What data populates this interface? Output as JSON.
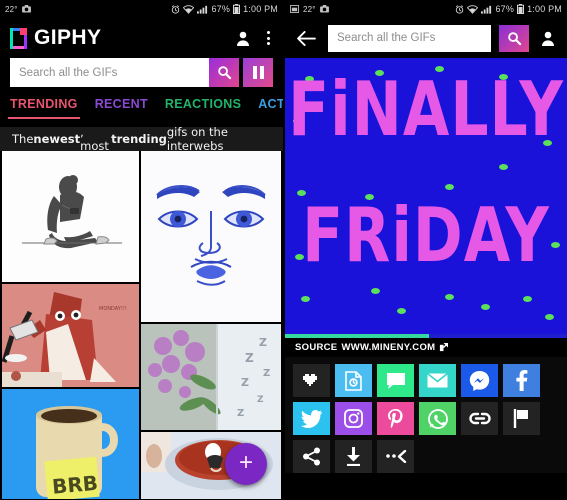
{
  "status_bar": {
    "temperature": "22°",
    "time": "1:00 PM",
    "battery_percent": "67%",
    "icons": [
      "screenshot-icon",
      "camera-icon",
      "alarm-icon",
      "wifi-icon",
      "signal-icon",
      "battery-icon"
    ]
  },
  "left_screen": {
    "app_title": "GIPHY",
    "actions": [
      {
        "name": "profile-icon",
        "label": "Profile"
      },
      {
        "name": "overflow-menu-icon",
        "label": "More options"
      }
    ],
    "search": {
      "placeholder": "Search all the GIFs",
      "value": "",
      "search_button": "search-icon",
      "pause_button": "pause-icon"
    },
    "tabs": [
      {
        "label": "TRENDING",
        "color": "#e8556f",
        "active": true
      },
      {
        "label": "RECENT",
        "color": "#8a4ad0",
        "active": false
      },
      {
        "label": "REACTIONS",
        "color": "#23b36a",
        "active": false
      },
      {
        "label": "ACTIO",
        "color": "#3a9ee0",
        "active": false
      }
    ],
    "banner": {
      "part1": "The ",
      "bold1": "newest",
      "part2": ", most ",
      "bold2": "trending",
      "part3": " gifs on the interwebs"
    },
    "gif_cards": [
      {
        "name": "gif-card-sketch-sitting",
        "description": "Pencil sketch of a person sitting on the ground looking at a phone"
      },
      {
        "name": "gif-card-red-fox",
        "description": "Illustration of a red fox at a desk with a lamp"
      },
      {
        "name": "gif-card-brb-coffee-mug",
        "description": "Coffee mug with a yellow BRB sticky note on blue background",
        "text": "BRB"
      },
      {
        "name": "gif-card-blue-pen-face",
        "description": "Blue ballpoint pen drawing of a woman's face"
      },
      {
        "name": "gif-card-flowers-sleep",
        "description": "Lilac flowers with floating Z sleep letters",
        "text": "Z"
      },
      {
        "name": "gif-card-coffee-cup-bath",
        "description": "Cartoon person bathing in a cup of coffee"
      }
    ],
    "fab": {
      "name": "create-gif-fab",
      "label": "+"
    }
  },
  "right_screen": {
    "back_button": "back-arrow-icon",
    "profile_button": "profile-icon",
    "search": {
      "placeholder": "Search all the GIFs",
      "value": "",
      "search_button": "search-icon"
    },
    "gif_detail": {
      "line1": "FiNALLY",
      "line2": "FRiDAY",
      "background_color": "#1a12d8",
      "text_color": "#e659e6",
      "dot_color": "#5ce05c",
      "progress_percent": 51
    },
    "source": {
      "label": "SOURCE",
      "url": "WWW.MINENY.COM",
      "icon": "external-link-icon"
    },
    "share_targets": [
      [
        {
          "name": "favorite-tile",
          "label": "Favorite",
          "icon": "pixel-heart-icon",
          "bg": "#232323",
          "fg": "#ffffff"
        },
        {
          "name": "saveto-tile",
          "label": "Save to",
          "icon": "document-save-icon",
          "bg": "#4cbdf0",
          "fg": "#ffffff"
        },
        {
          "name": "message-tile",
          "label": "Messages",
          "icon": "chat-bubble-icon",
          "bg": "#2ee88a",
          "fg": "#ffffff"
        },
        {
          "name": "email-tile",
          "label": "Email",
          "icon": "envelope-icon",
          "bg": "#33d6c8",
          "fg": "#ffffff"
        },
        {
          "name": "messenger-tile",
          "label": "Messenger",
          "icon": "messenger-icon",
          "bg": "#1b59e8",
          "fg": "#ffffff"
        },
        {
          "name": "facebook-tile",
          "label": "Facebook",
          "icon": "facebook-icon",
          "bg": "#3f7fe0",
          "fg": "#ffffff"
        }
      ],
      [
        {
          "name": "twitter-tile",
          "label": "Twitter",
          "icon": "twitter-bird-icon",
          "bg": "#2cc2f0",
          "fg": "#ffffff"
        },
        {
          "name": "instagram-tile",
          "label": "Instagram",
          "icon": "instagram-icon",
          "bg": "#9b4ee8",
          "fg": "#ffffff"
        },
        {
          "name": "pinterest-tile",
          "label": "Pinterest",
          "icon": "pinterest-icon",
          "bg": "#ec4b9b",
          "fg": "#ffffff"
        },
        {
          "name": "whatsapp-tile",
          "label": "WhatsApp",
          "icon": "whatsapp-icon",
          "bg": "#4fd367",
          "fg": "#ffffff"
        },
        {
          "name": "copylink-tile",
          "label": "Copy link",
          "icon": "link-chain-icon",
          "bg": "#232323",
          "fg": "#ffffff"
        },
        {
          "name": "report-tile",
          "label": "Report",
          "icon": "flag-icon",
          "bg": "#232323",
          "fg": "#ffffff"
        }
      ],
      [
        {
          "name": "share-tile",
          "label": "Share",
          "icon": "share-nodes-icon",
          "bg": "#232323",
          "fg": "#ffffff"
        },
        {
          "name": "download-tile",
          "label": "Download",
          "icon": "download-icon",
          "bg": "#232323",
          "fg": "#ffffff"
        },
        {
          "name": "more-tile",
          "label": "More",
          "icon": "more-back-icon",
          "bg": "#232323",
          "fg": "#ffffff"
        }
      ]
    ]
  }
}
